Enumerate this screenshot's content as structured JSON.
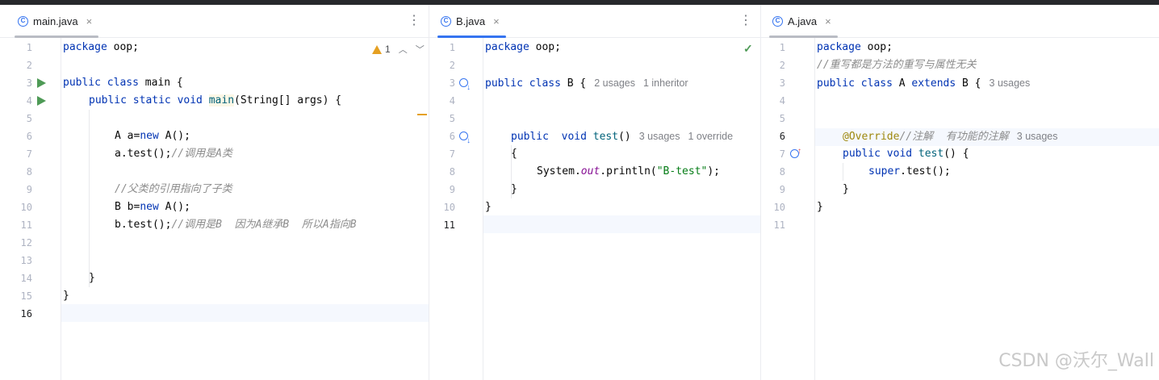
{
  "colors": {
    "accent": "#3574f0",
    "run": "#4e9a56",
    "warning": "#e5a022",
    "keyword": "#0033b3",
    "comment": "#8c8c8c",
    "string": "#067d17",
    "annotation": "#9e880d"
  },
  "panes": {
    "main": {
      "tab": {
        "label": "main.java",
        "close": "×",
        "icon": "class-run-icon"
      },
      "menu": "⋮",
      "warnings": {
        "count": "1",
        "up": "︿",
        "down": "﹀"
      },
      "lines": [
        "1",
        "2",
        "3",
        "4",
        "5",
        "6",
        "7",
        "8",
        "9",
        "10",
        "11",
        "12",
        "13",
        "14",
        "15",
        "16"
      ],
      "code": {
        "l1_kw": "package",
        "l1_rest": " oop;",
        "l3_kw": "public class",
        "l3_rest": " main {",
        "l4_kw": "public static void",
        "l4_fn": "main",
        "l4_rest": "(String[] args) {",
        "l6_a": "A a=",
        "l6_kw": "new",
        "l6_b": " A();",
        "l7_a": "a.test();",
        "l7_com": "//调用是A类",
        "l9_com": "//父类的引用指向了子类",
        "l10_a": "B b=",
        "l10_kw": "new",
        "l10_b": " A();",
        "l11_a": "b.test();",
        "l11_com": "//调用是B  因为A继承B  所以A指向B",
        "l14": "}",
        "l15": "}"
      }
    },
    "b": {
      "tab": {
        "label": "B.java",
        "close": "×",
        "icon": "class-icon"
      },
      "menu": "⋮",
      "status": "✓",
      "lines": [
        "1",
        "2",
        "3",
        "4",
        "5",
        "6",
        "7",
        "8",
        "9",
        "10",
        "11"
      ],
      "code": {
        "l1_kw": "package",
        "l1_rest": " oop;",
        "l3_kw": "public class",
        "l3_rest": " B {",
        "l3_hint1": "2 usages",
        "l3_hint2": "1 inheritor",
        "l6_kw1": "public",
        "l6_kw2": "void",
        "l6_fn": "test",
        "l6_rest": "()",
        "l6_hint1": "3 usages",
        "l6_hint2": "1 override",
        "l7": "{",
        "l8_a": "System.",
        "l8_stat": "out",
        "l8_b": ".println(",
        "l8_str": "\"B-test\"",
        "l8_c": ");",
        "l9": "}",
        "l10": "}"
      }
    },
    "a": {
      "tab": {
        "label": "A.java",
        "close": "×",
        "icon": "class-icon"
      },
      "lines": [
        "1",
        "2",
        "3",
        "4",
        "5",
        "6",
        "7",
        "8",
        "9",
        "10",
        "11"
      ],
      "code": {
        "l1_kw": "package",
        "l1_rest": " oop;",
        "l2_com": "//重写都是方法的重写与属性无关",
        "l3_kw": "public class",
        "l3_mid": " A ",
        "l3_kw2": "extends",
        "l3_rest": " B {",
        "l3_hint": "3 usages",
        "l6_ann": "@Override",
        "l6_com": "//注解  有功能的注解",
        "l6_hint": "3 usages",
        "l7_kw": "public void",
        "l7_fn": "test",
        "l7_rest": "() {",
        "l8_kw": "super",
        "l8_rest": ".test();",
        "l9": "}",
        "l10": "}"
      }
    }
  },
  "watermark": "CSDN @沃尔_Wall"
}
